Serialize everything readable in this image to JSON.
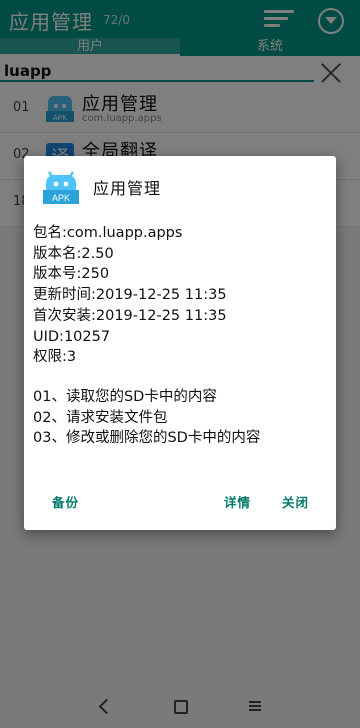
{
  "appbar": {
    "title": "应用管理",
    "count": "72/0"
  },
  "tabs": [
    "用户",
    "系统"
  ],
  "search": {
    "query": "luapp"
  },
  "list": [
    {
      "index": "01",
      "name": "应用管理",
      "package": "com.luapp.apps"
    },
    {
      "index": "02",
      "name": "全局翻译",
      "package": ""
    },
    {
      "index": "18",
      "name": "",
      "package": ""
    }
  ],
  "dialog": {
    "title": "应用管理",
    "icon_label": "APK",
    "info": [
      "包名:com.luapp.apps",
      "版本名:2.50",
      "版本号:250",
      "更新时间:2019-12-25 11:35",
      "首次安装:2019-12-25 11:35",
      "UID:10257",
      "权限:3"
    ],
    "permissions": [
      "01、读取您的SD卡中的内容",
      "02、请求安装文件包",
      "03、修改或删除您的SD卡中的内容"
    ],
    "buttons": {
      "backup": "备份",
      "details": "详情",
      "close": "关闭"
    }
  },
  "colors": {
    "accent": "#009688",
    "button": "#00796b",
    "apk_icon": "#4fc3f7"
  }
}
